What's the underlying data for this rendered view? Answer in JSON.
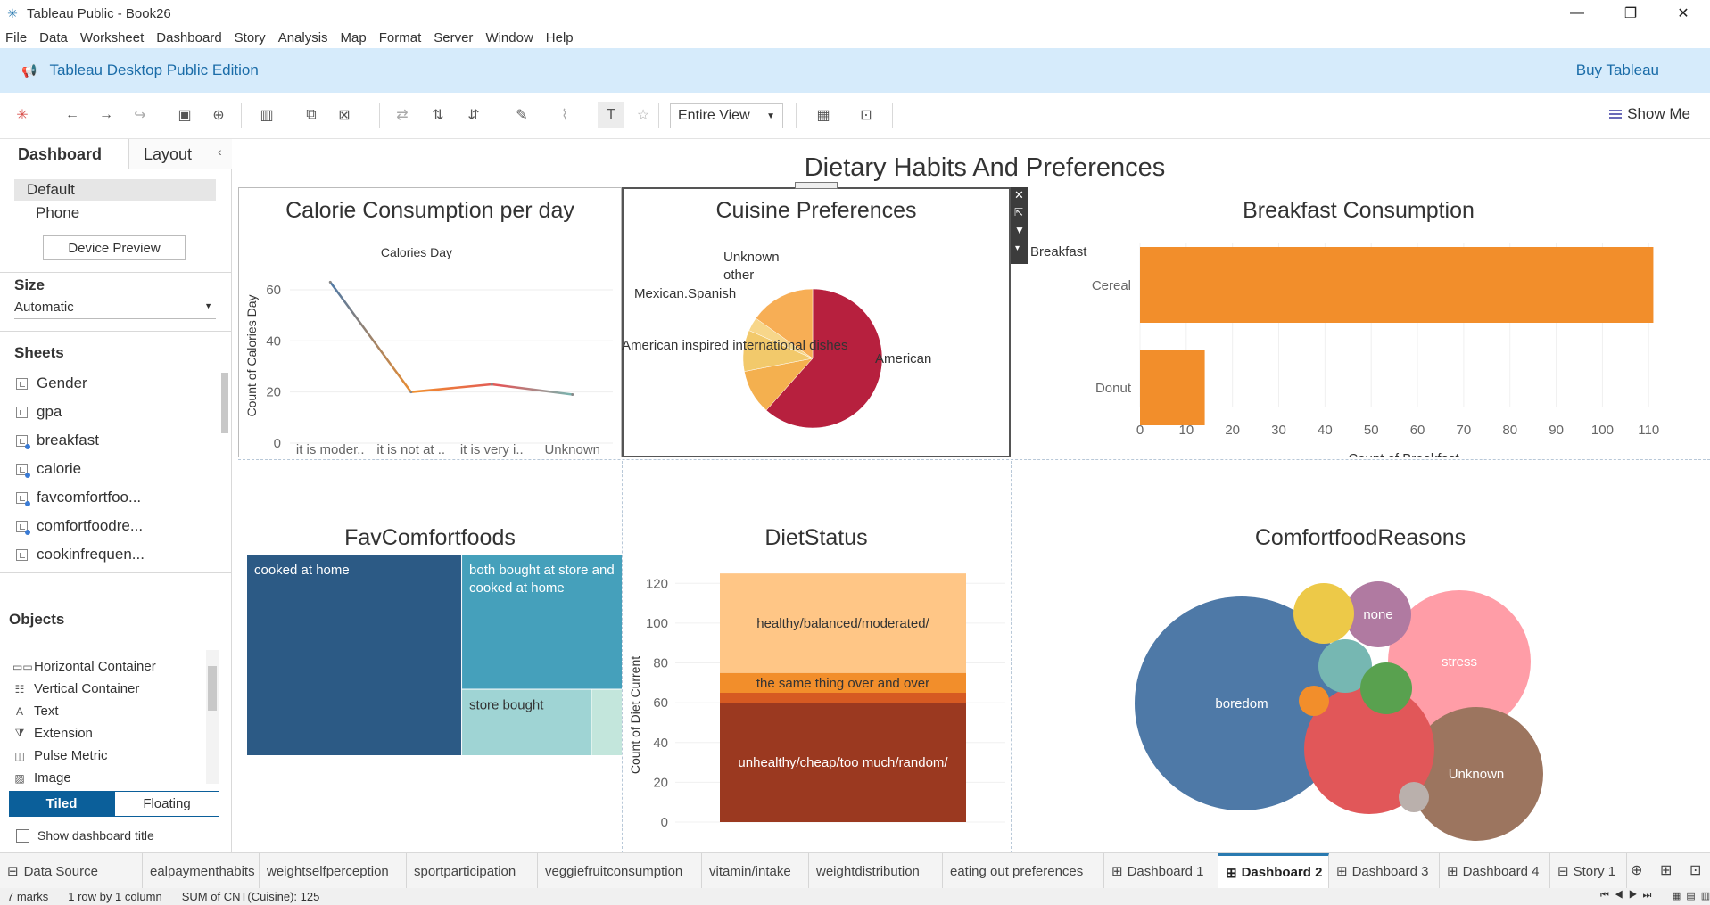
{
  "window": {
    "title": "Tableau Public - Book26",
    "minimize": "—",
    "restore": "❐",
    "close": "✕"
  },
  "menu": [
    "File",
    "Data",
    "Worksheet",
    "Dashboard",
    "Story",
    "Analysis",
    "Map",
    "Format",
    "Server",
    "Window",
    "Help"
  ],
  "banner": {
    "edition": "Tableau Desktop Public Edition",
    "buy": "Buy Tableau"
  },
  "toolbar": {
    "fit": "Entire View",
    "show_me": "Show Me"
  },
  "left_pane": {
    "tabs": [
      "Dashboard",
      "Layout"
    ],
    "devices": [
      "Default",
      "Phone"
    ],
    "device_preview": "Device Preview",
    "size_label": "Size",
    "size_value": "Automatic",
    "sheets_label": "Sheets",
    "sheets": [
      "Gender",
      "gpa",
      "breakfast",
      "calorie",
      "favcomfortfoo...",
      "comfortfoodre...",
      "cookinfrequen..."
    ],
    "objects_label": "Objects",
    "objects": [
      "Horizontal Container",
      "Vertical Container",
      "Text",
      "Extension",
      "Pulse Metric",
      "Image"
    ],
    "tiled": "Tiled",
    "floating": "Floating",
    "show_title": "Show dashboard title"
  },
  "dashboard": {
    "title": "Dietary Habits And Preferences"
  },
  "charts": {
    "calorie": {
      "title": "Calorie Consumption per day",
      "subtitle": "Calories Day",
      "ylabel": "Count of Calories Day"
    },
    "cuisine": {
      "title": "Cuisine Preferences"
    },
    "breakfast": {
      "title": "Breakfast Consumption",
      "header": "Breakfast",
      "xlabel": "Count of Breakfast"
    },
    "favcomfort": {
      "title": "FavComfortfoods"
    },
    "dietstatus": {
      "title": "DietStatus",
      "ylabel": "Count of Diet Current"
    },
    "reasons": {
      "title": "ComfortfoodReasons"
    }
  },
  "chart_data": [
    {
      "type": "line",
      "title": "Calorie Consumption per day",
      "subtitle": "Calories Day",
      "ylabel": "Count of Calories Day",
      "categories": [
        "it is moder..",
        "it is not at ..",
        "it is very i..",
        "Unknown"
      ],
      "values": [
        63,
        20,
        23,
        19
      ],
      "yticks": [
        0,
        20,
        40,
        60
      ],
      "ylim": [
        0,
        68
      ]
    },
    {
      "type": "pie",
      "title": "Cuisine Preferences",
      "slices": [
        {
          "label": "American",
          "value": 77,
          "color": "#b7203e"
        },
        {
          "label": "American inspired international dishes",
          "value": 13,
          "color": "#f4b04f"
        },
        {
          "label": "Mexican.Spanish",
          "value": 12,
          "color": "#f2c96b"
        },
        {
          "label": "other",
          "value": 4,
          "color": "#f7d68a"
        },
        {
          "label": "Unknown",
          "value": 19,
          "color": "#f7ae55"
        }
      ]
    },
    {
      "type": "bar",
      "orientation": "horizontal",
      "title": "Breakfast Consumption",
      "categories": [
        "Cereal",
        "Donut"
      ],
      "values": [
        111,
        14
      ],
      "xlabel": "Count of Breakfast",
      "xticks": [
        0,
        10,
        20,
        30,
        40,
        50,
        60,
        70,
        80,
        90,
        100,
        110
      ],
      "xlim": [
        0,
        114
      ],
      "color": "#f28e2b"
    },
    {
      "type": "treemap",
      "title": "FavComfortfoods",
      "items": [
        {
          "label": "cooked at home",
          "value": 66,
          "color": "#2c5a85"
        },
        {
          "label": "both bought at store and cooked at home",
          "value": 33,
          "color": "#45a0bb"
        },
        {
          "label": "store bought",
          "value": 13,
          "color": "#9fd4d4"
        },
        {
          "label": "",
          "value": 3,
          "color": "#c3e6dc"
        }
      ]
    },
    {
      "type": "bar",
      "orientation": "stacked",
      "title": "DietStatus",
      "ylabel": "Count of Diet Current",
      "yticks": [
        0,
        20,
        40,
        60,
        80,
        100,
        120
      ],
      "ylim": [
        0,
        130
      ],
      "segments": [
        {
          "label": "unhealthy/cheap/too much/random/",
          "value": 60,
          "color": "#9b3920"
        },
        {
          "label": "",
          "value": 5,
          "color": "#d65a22"
        },
        {
          "label": "the same thing over and over",
          "value": 10,
          "color": "#f28e2b"
        },
        {
          "label": "healthy/balanced/moderated/",
          "value": 50,
          "color": "#ffc686"
        }
      ]
    },
    {
      "type": "bubble",
      "title": "ComfortfoodReasons",
      "bubbles": [
        {
          "label": "boredom",
          "color": "#4e79a7"
        },
        {
          "label": "stress",
          "color": "#ff9da7"
        },
        {
          "label": "Unknown",
          "color": "#9c755f"
        },
        {
          "label": "none",
          "color": "#b07aa1"
        },
        {
          "label": "",
          "color": "#e15759"
        },
        {
          "label": "",
          "color": "#edc948"
        },
        {
          "label": "",
          "color": "#76b7b2"
        },
        {
          "label": "",
          "color": "#59a14f"
        },
        {
          "label": "",
          "color": "#f28e2b"
        },
        {
          "label": "",
          "color": "#bab0ac"
        }
      ]
    }
  ],
  "sheet_tabs": [
    "Data Source",
    "ealpaymenthabits",
    "weightselfperception",
    "sportparticipation",
    "veggiefruitconsumption",
    "vitamin/intake",
    "weightdistribution",
    "eating out preferences",
    "Dashboard 1",
    "Dashboard 2",
    "Dashboard 3",
    "Dashboard 4",
    "Story 1"
  ],
  "status": {
    "marks": "7 marks",
    "rows": "1 row by 1 column",
    "sum": "SUM of CNT(Cuisine): 125"
  }
}
